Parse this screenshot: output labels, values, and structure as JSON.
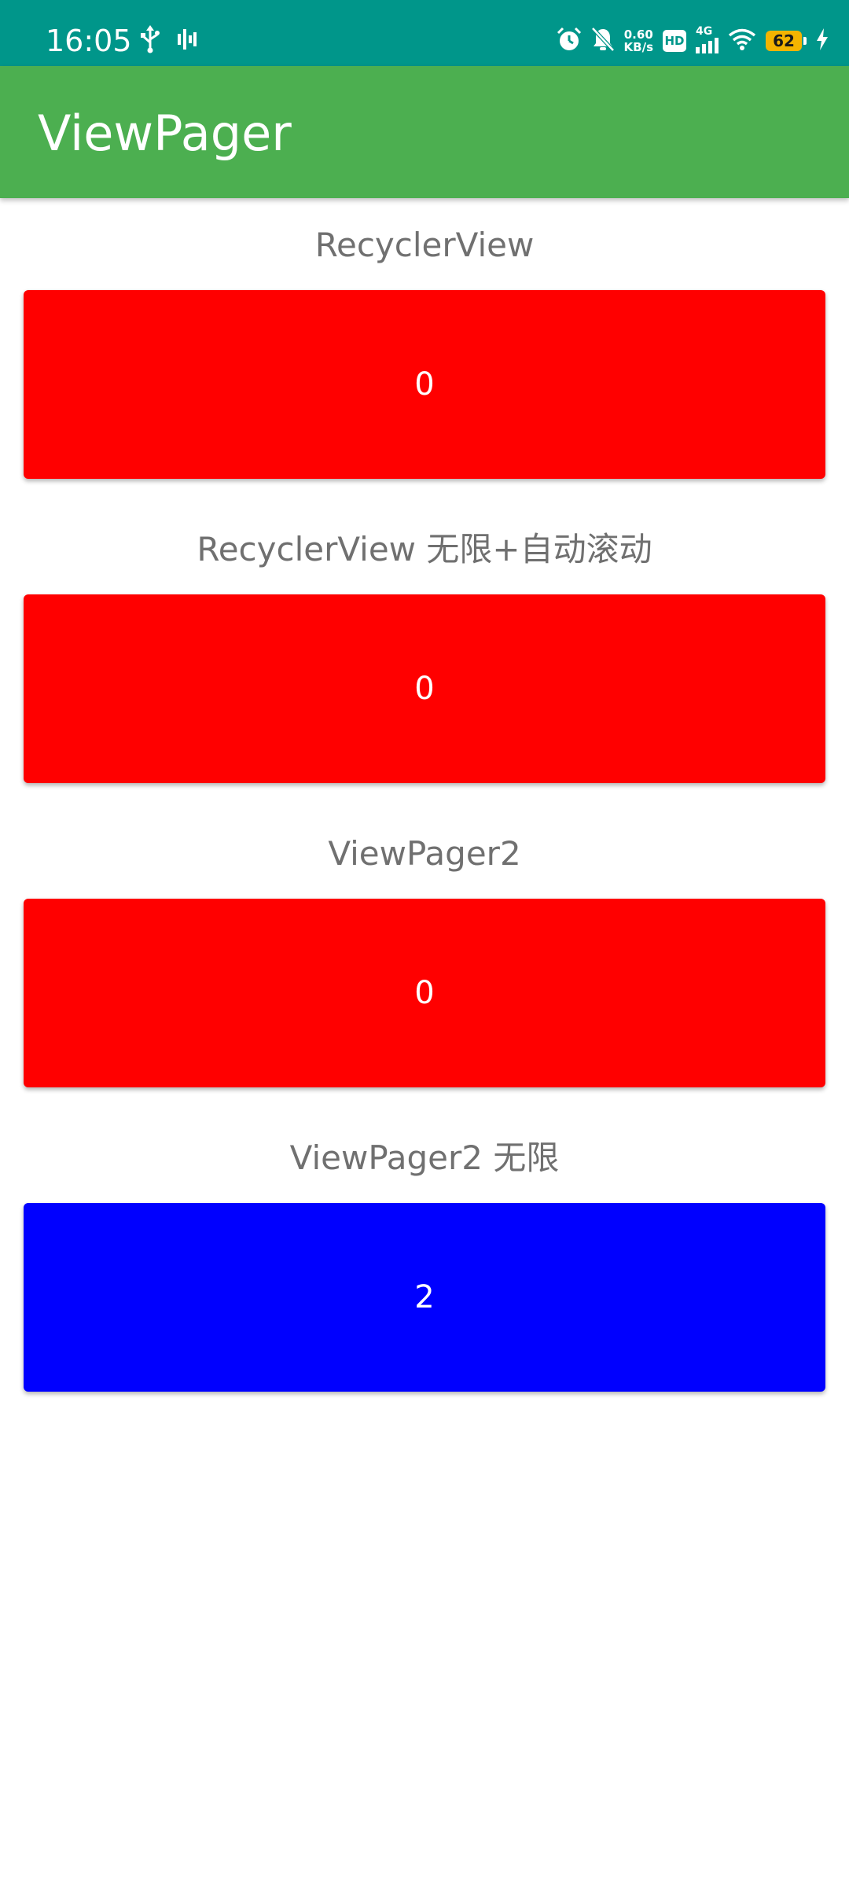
{
  "status_bar": {
    "time": "16:05",
    "net_speed_value": "0.60",
    "net_speed_unit": "KB/s",
    "hd_label": "HD",
    "network_type": "4G",
    "battery_level": "62",
    "background_color": "#00968A"
  },
  "app_bar": {
    "title": "ViewPager",
    "background_color": "#4CAF50"
  },
  "sections": [
    {
      "title": "RecyclerView",
      "page_label": "0",
      "color": "#FF0000"
    },
    {
      "title": "RecyclerView 无限+自动滚动",
      "page_label": "0",
      "color": "#FF0000"
    },
    {
      "title": "ViewPager2",
      "page_label": "0",
      "color": "#FF0000"
    },
    {
      "title": "ViewPager2 无限",
      "page_label": "2",
      "color": "#0000FF"
    }
  ]
}
